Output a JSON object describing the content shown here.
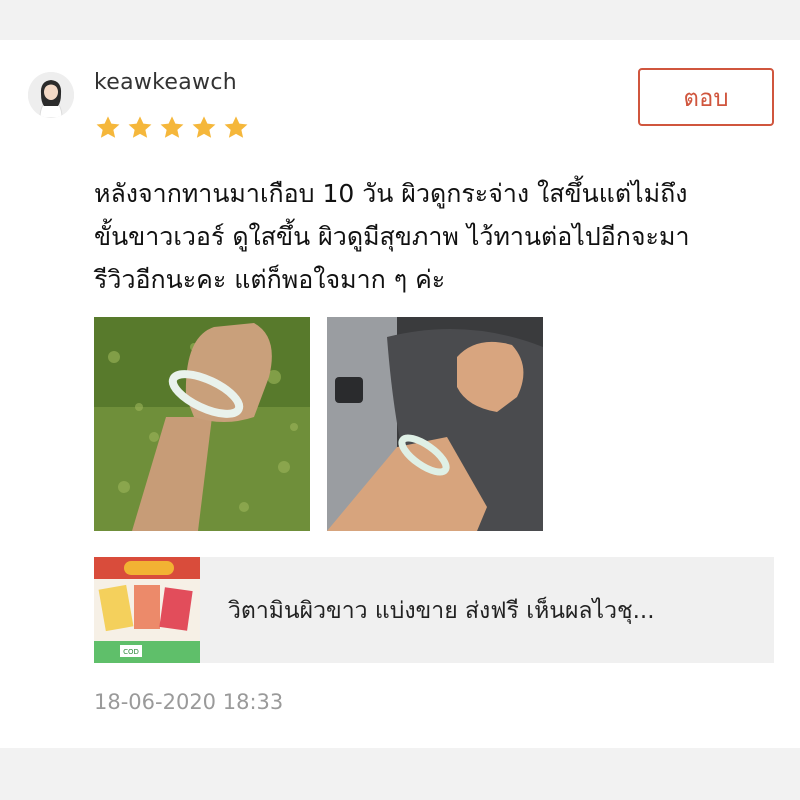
{
  "review": {
    "username": "keawkeawch",
    "rating": 5,
    "reply_label": "ตอบ",
    "text_lines": [
      "หลังจากทานมาเกือบ 10 วัน ผิวดูกระจ่าง ใสขึ้นแต่ไม่ถึง",
      "ขั้นขาวเวอร์ ดูใสขึ้น ผิวดูมีสุขภาพ ไว้ทานต่อไปอีกจะมา",
      "รีวิวอีกนะคะ แต่ก็พอใจมาก ๆ ค่ะ"
    ],
    "timestamp": "18-06-2020 18:33"
  },
  "product": {
    "title": "วิตามินผิวขาว แบ่งขาย ส่งฟรี เห็นผลไวชุ...",
    "thumb_badge": "COD"
  },
  "colors": {
    "accent": "#d0563e",
    "star": "#f5b73b",
    "background_band": "#f2f2f2"
  }
}
